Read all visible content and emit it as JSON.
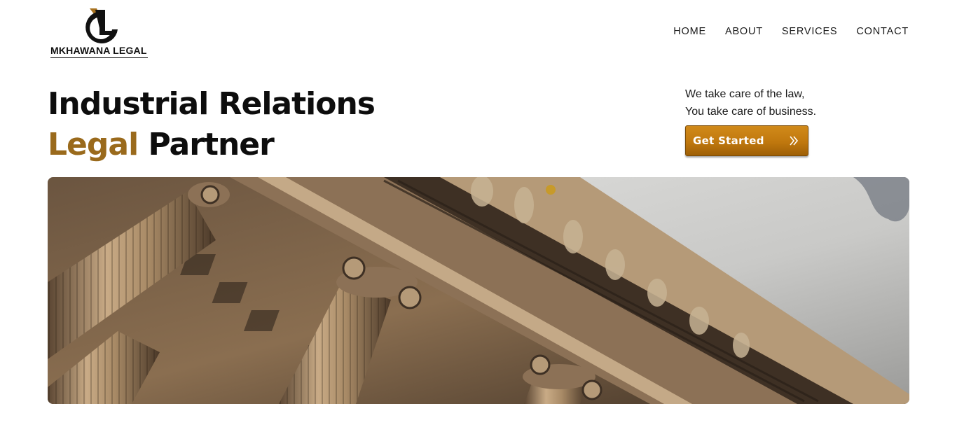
{
  "brand": {
    "logo_text": "MKHAWANA LEGAL",
    "logo_initials": "ML",
    "accent_color": "#9a6a1c"
  },
  "nav": {
    "items": [
      {
        "label": "HOME"
      },
      {
        "label": "ABOUT"
      },
      {
        "label": "SERVICES"
      },
      {
        "label": "CONTACT"
      }
    ]
  },
  "hero": {
    "title_line1": "Industrial Relations",
    "title_accent": "Legal",
    "title_rest": "Partner",
    "tagline_line1": "We take care of the law,",
    "tagline_line2": "You take care of business.",
    "cta_label": "Get Started",
    "cta_icon": "double-chevron-right-icon",
    "image_subject": "courthouse-columns-photo"
  }
}
